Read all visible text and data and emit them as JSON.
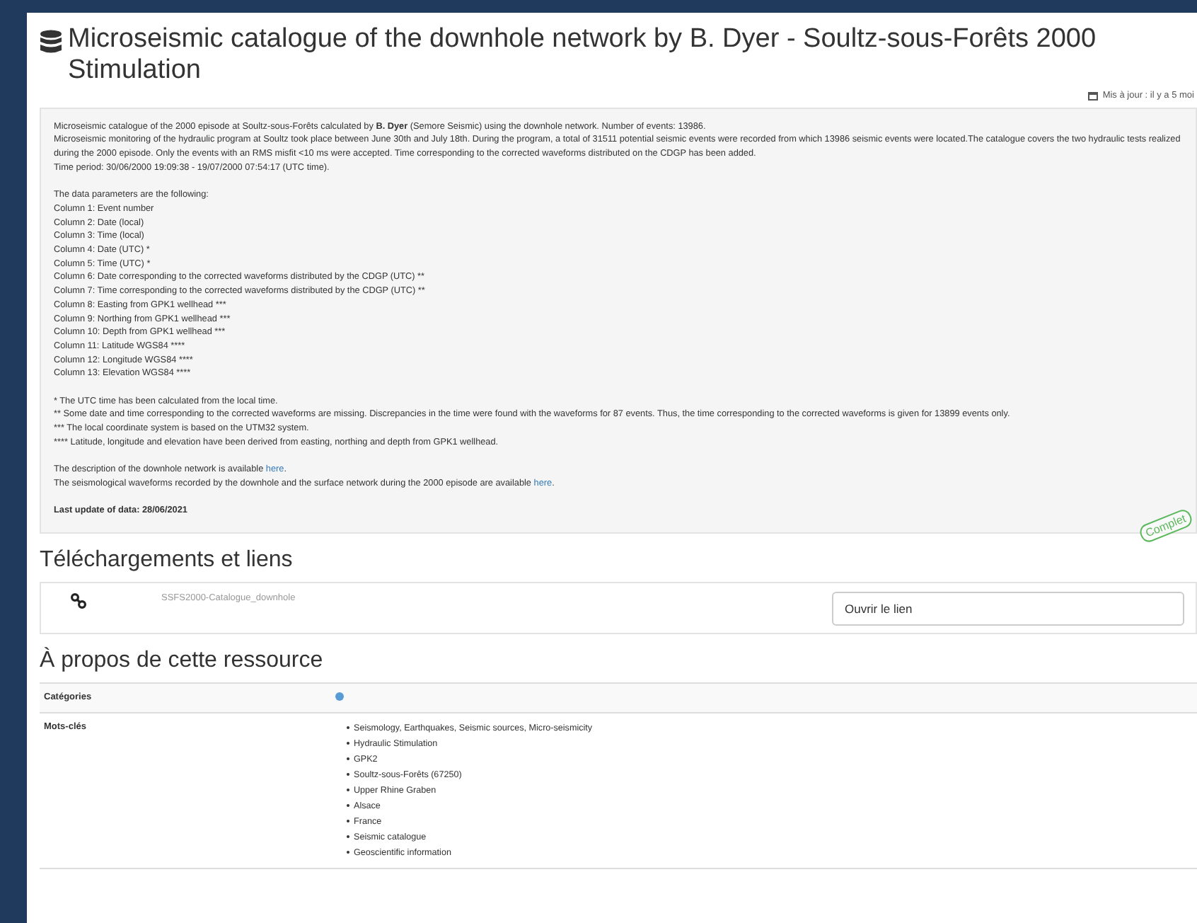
{
  "title": "Microseismic catalogue of the downhole network by B. Dyer - Soultz-sous-Forêts 2000 Stimulation",
  "updated": "Mis à jour : il y a 5 moi",
  "description": {
    "paragraphs": [
      [
        "Microseismic catalogue of the 2000 episode at Soultz-sous-Forêts calculated by **B. Dyer** (Semore Seismic) using the downhole network. Number of events: 13986.",
        "Microseismic monitoring of the hydraulic program at Soultz took place between June 30th and July 18th. During the program, a total of 31511 potential seismic events were recorded from which 13986 seismic events were located.The catalogue covers the two hydraulic tests realized during the 2000 episode. Only the events with an RMS misfit <10 ms were accepted. Time corresponding to the corrected waveforms distributed on the CDGP has been added.",
        "Time period: 30/06/2000 19:09:38 - 19/07/2000 07:54:17 (UTC time)."
      ],
      [
        "The data parameters are the following:",
        "Column 1: Event number",
        "Column 2: Date (local)",
        "Column 3: Time (local)",
        "Column 4: Date (UTC) *",
        "Column 5: Time (UTC) *",
        "Column 6: Date corresponding to the corrected waveforms distributed by the CDGP (UTC) **",
        "Column 7: Time corresponding to the corrected waveforms distributed by the CDGP (UTC) **",
        "Column 8: Easting from GPK1 wellhead ***",
        "Column 9: Northing from GPK1 wellhead ***",
        "Column 10: Depth from GPK1 wellhead ***",
        "Column 11: Latitude WGS84 ****",
        "Column 12: Longitude WGS84 ****",
        "Column 13: Elevation WGS84 ****"
      ],
      [
        "* The UTC time has been calculated from the local time.",
        "** Some date and time corresponding to the corrected waveforms are missing. Discrepancies in the time were found with the waveforms for 87 events. Thus, the time corresponding to the corrected waveforms is given for 13899 events only.",
        "*** The local coordinate system is based on the UTM32 system.",
        "**** Latitude, longitude and elevation have been derived from easting, northing and depth from GPK1 wellhead."
      ]
    ],
    "links": [
      {
        "before": "The description of the downhole network is available ",
        "link": "here",
        "after": "."
      },
      {
        "before": "The seismological waveforms recorded by the downhole and the surface network during the 2000 episode are available ",
        "link": "here",
        "after": "."
      }
    ],
    "last_update": "Last update of data: 28/06/2021",
    "stamp": "Complet"
  },
  "downloads": {
    "heading": "Téléchargements et liens",
    "items": [
      {
        "name": "SSFS2000-Catalogue_downhole",
        "button": "Ouvrir le lien"
      }
    ]
  },
  "about": {
    "heading": "À propos de cette ressource",
    "rows": [
      {
        "label": "Catégories",
        "kind": "dot"
      },
      {
        "label": "Mots-clés",
        "kind": "list",
        "items": [
          "Seismology, Earthquakes, Seismic sources, Micro-seismicity",
          "Hydraulic Stimulation",
          "GPK2",
          "Soultz-sous-Forêts (67250)",
          "Upper Rhine Graben",
          "Alsace",
          "France",
          "Seismic catalogue",
          "Geoscientific information"
        ]
      }
    ]
  }
}
